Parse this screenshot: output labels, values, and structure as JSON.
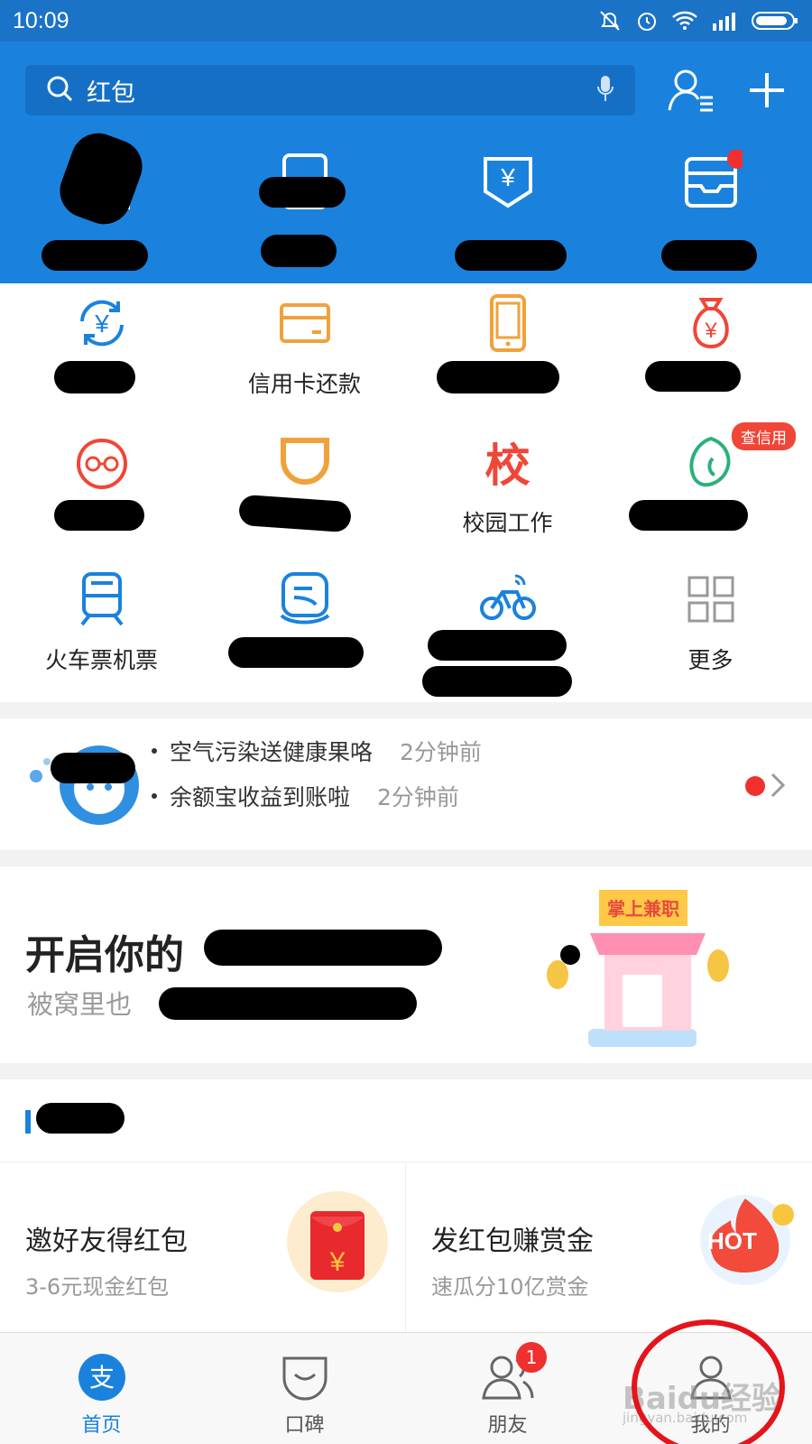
{
  "status": {
    "time": "10:09"
  },
  "search": {
    "placeholder": "红包"
  },
  "quick_actions": [
    {
      "icon": "scan-icon"
    },
    {
      "icon": "card-icon"
    },
    {
      "icon": "yen-bag-icon"
    },
    {
      "icon": "wallet-card-icon"
    }
  ],
  "grid": [
    {
      "icon": "yen-transfer-icon",
      "label": ""
    },
    {
      "icon": "credit-card-icon",
      "label": "信用卡还款"
    },
    {
      "icon": "phone-icon",
      "label": ""
    },
    {
      "icon": "money-bag-icon",
      "label": ""
    },
    {
      "icon": "glasses-face-icon",
      "label": ""
    },
    {
      "icon": "didi-icon",
      "label": ""
    },
    {
      "icon": "school-icon",
      "label": "校园工作",
      "glyph": "校"
    },
    {
      "icon": "sesame-icon",
      "label": "",
      "badge": "查信用"
    },
    {
      "icon": "train-icon",
      "label": "火车票机票"
    },
    {
      "icon": "hand-card-icon",
      "label": ""
    },
    {
      "icon": "bike-icon",
      "label": ""
    },
    {
      "icon": "more-grid-icon",
      "label": "更多"
    }
  ],
  "messages": [
    {
      "text": "空气污染送健康果咯",
      "time": "2分钟前"
    },
    {
      "text": "余额宝收益到账啦",
      "time": "2分钟前"
    }
  ],
  "banner": {
    "title": "开启你的",
    "subtitle": "被窝里也",
    "image_text": "掌上兼职"
  },
  "promos": [
    {
      "title": "邀好友得红包",
      "subtitle": "3-6元现金红包"
    },
    {
      "title": "发红包赚赏金",
      "subtitle": "速瓜分10亿赏金",
      "badge": "HOT"
    }
  ],
  "tabs": [
    {
      "label": "首页",
      "icon": "alipay-icon",
      "active": true
    },
    {
      "label": "口碑",
      "icon": "koubei-icon"
    },
    {
      "label": "朋友",
      "icon": "friends-icon",
      "count": "1"
    },
    {
      "label": "我的",
      "icon": "me-icon"
    }
  ],
  "watermark": {
    "text": "Baidu经验",
    "sub": "jingyan.baidu.com"
  },
  "colors": {
    "primary": "#1a82dd",
    "orange": "#f0a23a",
    "red": "#f04637"
  }
}
